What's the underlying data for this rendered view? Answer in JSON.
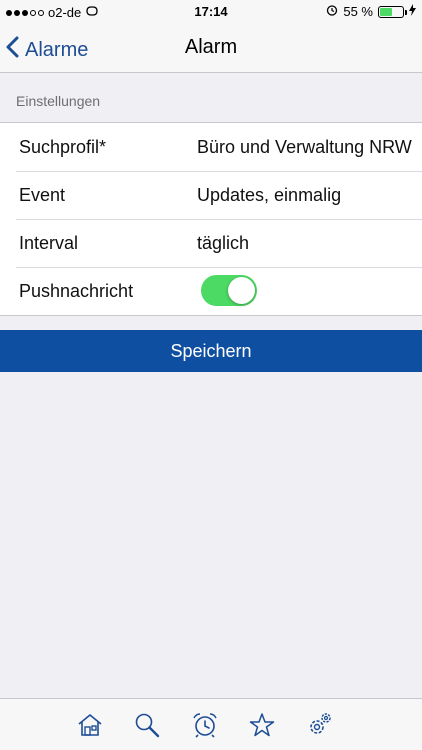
{
  "status_bar": {
    "carrier": "o2-de",
    "time": "17:14",
    "battery": "55 %",
    "battery_level": 0.55
  },
  "nav": {
    "back_label": "Alarme",
    "title": "Alarm"
  },
  "section": {
    "header": "Einstellungen"
  },
  "settings": [
    {
      "label": "Suchprofil*",
      "value": "Büro und Verwaltung NRW"
    },
    {
      "label": "Event",
      "value": "Updates, einmalig"
    },
    {
      "label": "Interval",
      "value": "täglich"
    },
    {
      "label": "Pushnachricht",
      "toggle": true
    }
  ],
  "save_button": {
    "label": "Speichern"
  },
  "tab_bar": {
    "items": [
      "home-icon",
      "search-icon",
      "alarm-clock-icon",
      "star-icon",
      "settings-icon"
    ]
  },
  "colors": {
    "accent": "#1d4d94",
    "button": "#0f4fa1",
    "toggle_on": "#4cd964"
  }
}
